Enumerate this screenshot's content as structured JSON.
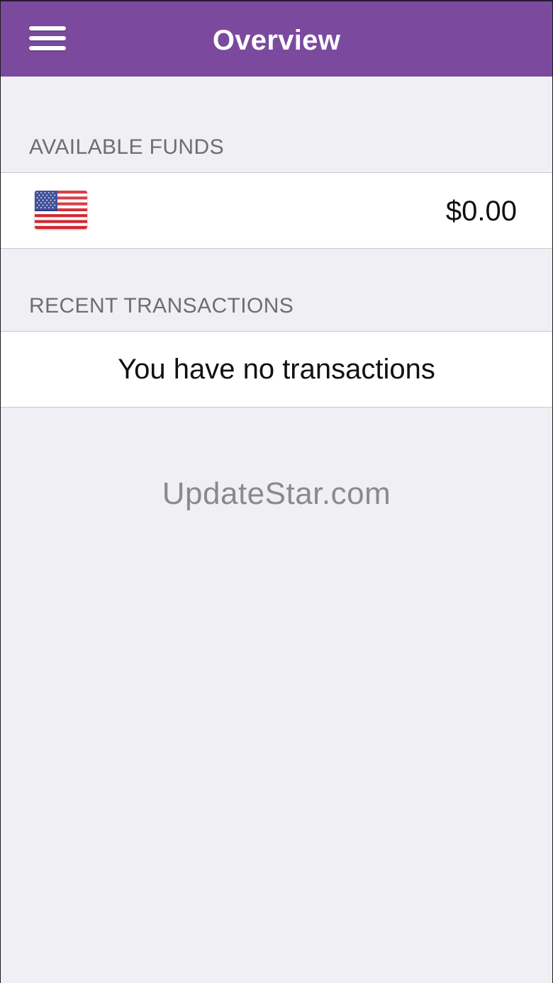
{
  "navbar": {
    "title": "Overview",
    "menu_icon": "hamburger-menu-icon",
    "color": "#7b4a9e"
  },
  "available_funds": {
    "header": "AVAILABLE FUNDS",
    "items": [
      {
        "currency_flag_icon": "us-flag-icon",
        "amount": "$0.00"
      }
    ]
  },
  "recent_transactions": {
    "header": "RECENT TRANSACTIONS",
    "empty_message": "You have no transactions"
  },
  "watermark": {
    "text": "UpdateStar.com"
  }
}
